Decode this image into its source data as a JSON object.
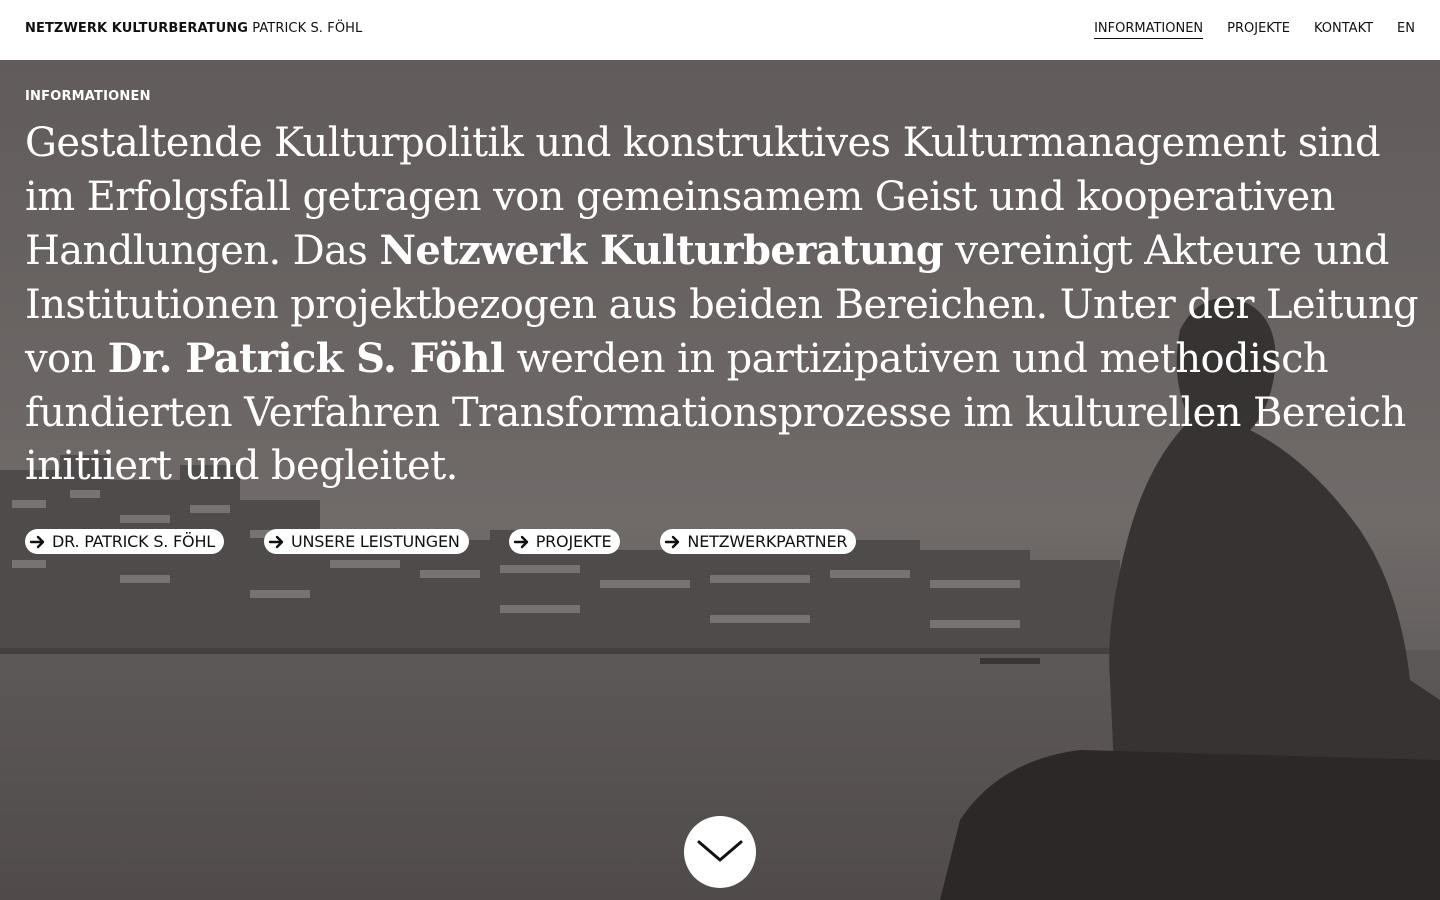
{
  "header": {
    "brand_bold": "NETZWERK KULTURBERATUNG",
    "brand_regular": "PATRICK S. FÖHL",
    "nav": [
      {
        "label": "INFORMATIONEN",
        "active": true
      },
      {
        "label": "PROJEKTE",
        "active": false
      },
      {
        "label": "KONTAKT",
        "active": false
      },
      {
        "label": "EN",
        "active": false
      }
    ]
  },
  "hero": {
    "section_label": "INFORMATIONEN",
    "intro": {
      "part1": "Gestaltende Kulturpolitik und konstruktives Kulturmanagement sind im Erfolgsfall getragen von gemeinsamem Geist und kooperativen Handlungen. Das ",
      "bold1": "Netzwerk Kulturberatung",
      "part2": " vereinigt Akteure und Institutionen projektbezogen aus beiden Bereichen. Unter der Leitung von ",
      "bold2": "Dr. Patrick S. Föhl",
      "part3": " werden in partizipativen und methodisch fundierten Verfahren Transformationsprozesse im kulturellen Bereich initiiert und begleitet."
    },
    "links": [
      {
        "label": "DR. PATRICK S. FÖHL",
        "icon": "arrow-right-icon"
      },
      {
        "label": "UNSERE LEISTUNGEN",
        "icon": "arrow-right-icon"
      },
      {
        "label": "PROJEKTE",
        "icon": "arrow-right-icon"
      },
      {
        "label": "NETZWERKPARTNER",
        "icon": "arrow-right-icon"
      }
    ],
    "scroll_icon": "chevron-down-icon"
  },
  "colors": {
    "header_bg": "#ffffff",
    "text_dark": "#111111",
    "hero_text": "#ffffff",
    "pill_bg": "#ffffff"
  }
}
